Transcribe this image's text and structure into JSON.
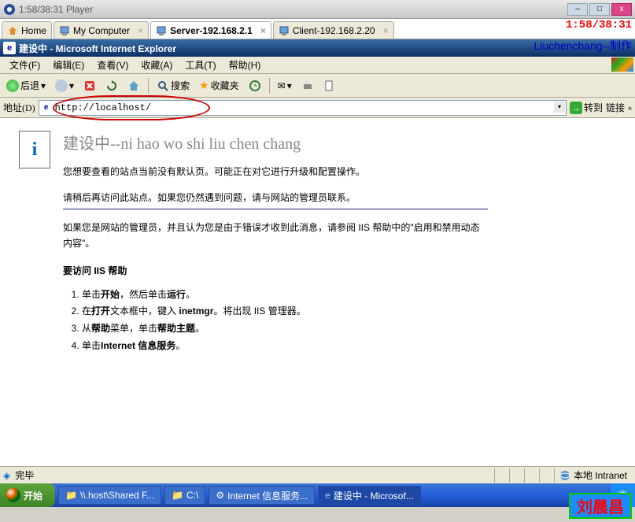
{
  "player": {
    "title": "1:58/38:31 Player",
    "overlay_time": "1:58/38:31",
    "author_overlay": "Liuchenchang--制作"
  },
  "vm_tabs": [
    {
      "icon": "home",
      "label": "Home"
    },
    {
      "icon": "pc",
      "label": "My Computer"
    },
    {
      "icon": "pc",
      "label": "Server-192.168.2.1",
      "active": true
    },
    {
      "icon": "pc",
      "label": "Client-192.168.2.20"
    }
  ],
  "ie": {
    "title": "建设中 - Microsoft Internet Explorer",
    "menus": [
      "文件(F)",
      "编辑(E)",
      "查看(V)",
      "收藏(A)",
      "工具(T)",
      "帮助(H)"
    ],
    "toolbar": {
      "back": "后退",
      "search": "搜索",
      "favorites": "收藏夹"
    },
    "addr_label": "地址(D)",
    "url": "http://localhost/",
    "go": "转到",
    "links": "链接"
  },
  "page": {
    "heading": "建设中--ni hao wo shi liu chen chang",
    "p1": "您想要查看的站点当前没有默认页。可能正在对它进行升级和配置操作。",
    "p2": "请稍后再访问此站点。如果您仍然遇到问题，请与网站的管理员联系。",
    "p3a": "如果您是网站的管理员，并且认为您是由于错误才收到此消息，请参阅 IIS 帮助中的\"启用和禁用动态内容\"。",
    "h2": "要访问 IIS 帮助",
    "steps": [
      {
        "pre": "单击",
        "b1": "开始",
        "mid": "，然后单击",
        "b2": "运行",
        "post": "。"
      },
      {
        "pre": "在",
        "b1": "打开",
        "mid": "文本框中，键入 ",
        "b2": "inetmgr",
        "post": "。将出现 IIS 管理器。"
      },
      {
        "pre": "从",
        "b1": "帮助",
        "mid": "菜单，单击",
        "b2": "帮助主题",
        "post": "。"
      },
      {
        "pre": "单击",
        "b1": "Internet 信息服务",
        "mid": "",
        "b2": "",
        "post": "。"
      }
    ]
  },
  "status": {
    "done": "完毕",
    "zone": "本地 Intranet"
  },
  "taskbar": {
    "start": "开始",
    "items": [
      "\\\\.host\\Shared F...",
      "C:\\",
      "Internet 信息服务...",
      "建设中 - Microsof..."
    ]
  },
  "name_overlay": "刘晨昌"
}
